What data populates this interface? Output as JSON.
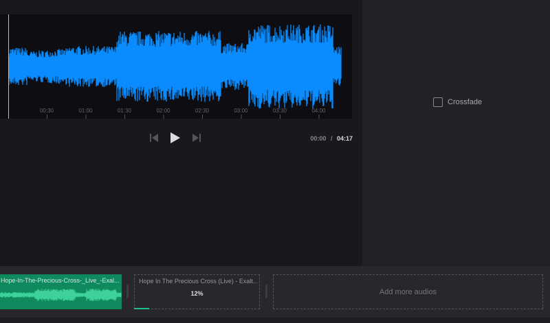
{
  "waveform": {
    "ticks": [
      "00:30",
      "01:00",
      "01:30",
      "02:00",
      "02:30",
      "03:00",
      "03:30",
      "04:00"
    ],
    "color": "#0a8cff"
  },
  "player": {
    "current": "00:00",
    "separator": "/",
    "total": "04:17"
  },
  "options": {
    "crossfade_label": "Crossfade",
    "crossfade_checked": false
  },
  "tracks": [
    {
      "name": "Hope-In-The-Precious-Cross-_Live_-Exal..."
    },
    {
      "name": "Hope In The Precious Cross (Live) - Exalt...",
      "progress_label": "12%",
      "progress": 0.12
    }
  ],
  "add_label": "Add more audios"
}
